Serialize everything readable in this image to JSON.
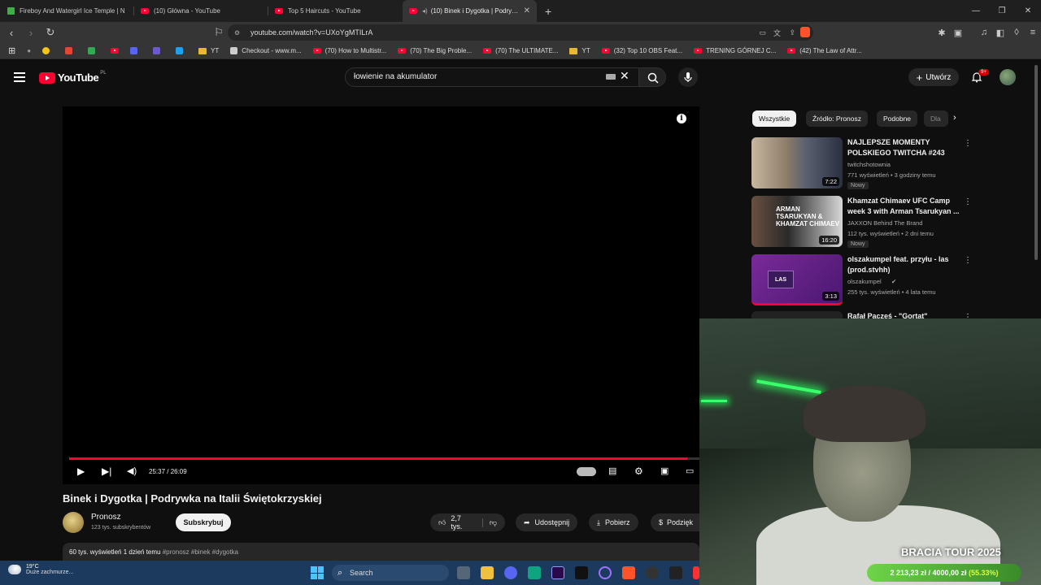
{
  "browser": {
    "tabs": [
      {
        "title": "Fireboy And Watergirl Ice Temple | N",
        "active": false
      },
      {
        "title": "(10) Główna - YouTube",
        "active": false
      },
      {
        "title": "Top 5 Haircuts - YouTube",
        "active": false
      },
      {
        "title": "(10) Binek i Dygotka | Podrywka",
        "active": true
      }
    ],
    "url": "youtube.com/watch?v=UXoYgMTILrA",
    "bookmarks": [
      {
        "label": "YT",
        "type": "folder"
      },
      {
        "label": "Checkout - www.m...",
        "type": "link"
      },
      {
        "label": "(70) How to Multistr...",
        "type": "link"
      },
      {
        "label": "(70) The Big Proble...",
        "type": "link"
      },
      {
        "label": "(70) The ULTIMATE...",
        "type": "link"
      },
      {
        "label": "YT",
        "type": "folder"
      },
      {
        "label": "(32) Top 10 OBS Feat...",
        "type": "link"
      },
      {
        "label": "TRENING GÓRNEJ C...",
        "type": "link"
      },
      {
        "label": "(42) The Law of Attr...",
        "type": "link"
      }
    ]
  },
  "youtube": {
    "logo": "YouTube",
    "country": "PL",
    "search_value": "łowienie na akumulator",
    "create_label": "Utwórz",
    "notif_badge": "9+",
    "player": {
      "time": "25:37 / 26:09",
      "progress": 0.98
    },
    "video": {
      "title": "Binek i Dygotka | Podrywka na Italii Świętokrzyskiej",
      "channel": "Pronosz",
      "subs": "123 tys. subskrybentów",
      "subscribe_label": "Subskrybuj",
      "likes": "2,7 tys.",
      "share_label": "Udostępnij",
      "download_label": "Pobierz",
      "thanks_label": "Podzięk",
      "views_line": "60 tys. wyświetleń  1 dzień temu",
      "tags": "#pronosz #binek #dygotka"
    },
    "chips": [
      "Wszystkie",
      "Źródło: Pronosz",
      "Podobne",
      "Dla"
    ],
    "recommendations": [
      {
        "title": "NAJLEPSZE MOMENTY POLSKIEGO TWITCHA #243",
        "channel": "twitchshotownia",
        "meta": "771 wyświetleń • 3 godziny temu",
        "duration": "7:22",
        "badge": "Nowy"
      },
      {
        "title": "Khamzat Chimaev UFC Camp week 3 with Arman Tsarukyan ...",
        "channel": "JAXXON Behind The Brand",
        "meta": "112 tys. wyświetleń • 2 dni temu",
        "duration": "16:20",
        "badge": "Nowy",
        "thumb_text": "ARMAN TSARUKYAN & KHAMZAT CHIMAEV"
      },
      {
        "title": "olszakumpel feat. przyłu - las (prod.stvhh)",
        "channel": "olszakumpel",
        "meta": "255 tys. wyświetleń • 4 lata temu",
        "duration": "3:13",
        "thumb_text": "LAS"
      },
      {
        "title": "Rafał Pacześ - \"Gortat\"",
        "channel": "",
        "meta": "",
        "duration": ""
      }
    ]
  },
  "overlay": {
    "tour": "BRACIA TOUR 2025",
    "goal": "2 213,23 zł / 4000,00 zł",
    "goal_pct": "(55.33%)",
    "goal_fraction": 0.5533
  },
  "taskbar": {
    "temp": "19°C",
    "weather": "Duże zachmurze...",
    "search": "Search"
  }
}
